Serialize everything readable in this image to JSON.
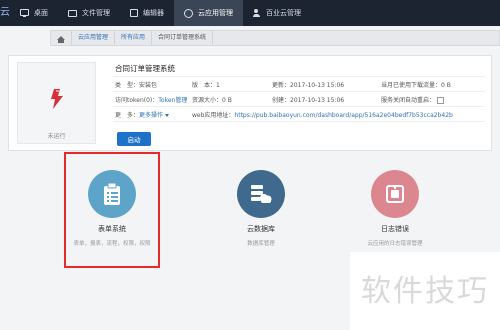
{
  "nav": {
    "items": [
      {
        "label": "桌面",
        "icon": "monitor-icon"
      },
      {
        "label": "文件管理",
        "icon": "folder-icon"
      },
      {
        "label": "编辑器",
        "icon": "edit-icon"
      },
      {
        "label": "云应用管理",
        "icon": "cloud-icon"
      },
      {
        "label": "百业云管理",
        "icon": "users-icon"
      }
    ],
    "active_index": 3,
    "brand_fragment": "云"
  },
  "breadcrumb": {
    "items": [
      "云应用管理",
      "所有应用",
      "合同订单管理系统"
    ]
  },
  "app": {
    "name": "合同订单管理系统",
    "status": "未运行",
    "type_label": "类　型：",
    "type_value": "安装包",
    "version_label": "版　本：",
    "version_value": "1",
    "updated_label": "更新：",
    "updated_value": "2017-10-13 15:06",
    "download_label": "当月已使用下载流量：",
    "download_value": "0 B",
    "token_label": "访问token(0)：",
    "token_link": "Token管理",
    "resource_label": "资源大小：",
    "resource_value": "0 B",
    "created_label": "创建：",
    "created_value": "2017-10-13 15:06",
    "deploy_label": "服务关闭自动重启：",
    "more_label": "更　多：",
    "more_link": "更多操作",
    "url_label": "web应用地址：",
    "url_value": "https://pub.baibaoyun.com/dashboard/app/516a2e04bedf7b53cca2b42b",
    "launch_button": "启动"
  },
  "modules": [
    {
      "title": "表单系统",
      "desc": "表单，报表，流程，权限，权限",
      "color": "#5ea4c9",
      "icon": "form-list-icon"
    },
    {
      "title": "云数据库",
      "desc": "数据库管理",
      "color": "#40698e",
      "icon": "cloud-database-icon"
    },
    {
      "title": "日志错误",
      "desc": "云应用的日志错误管理",
      "color": "#dc8790",
      "icon": "log-error-icon"
    }
  ],
  "watermark": "软件技巧"
}
